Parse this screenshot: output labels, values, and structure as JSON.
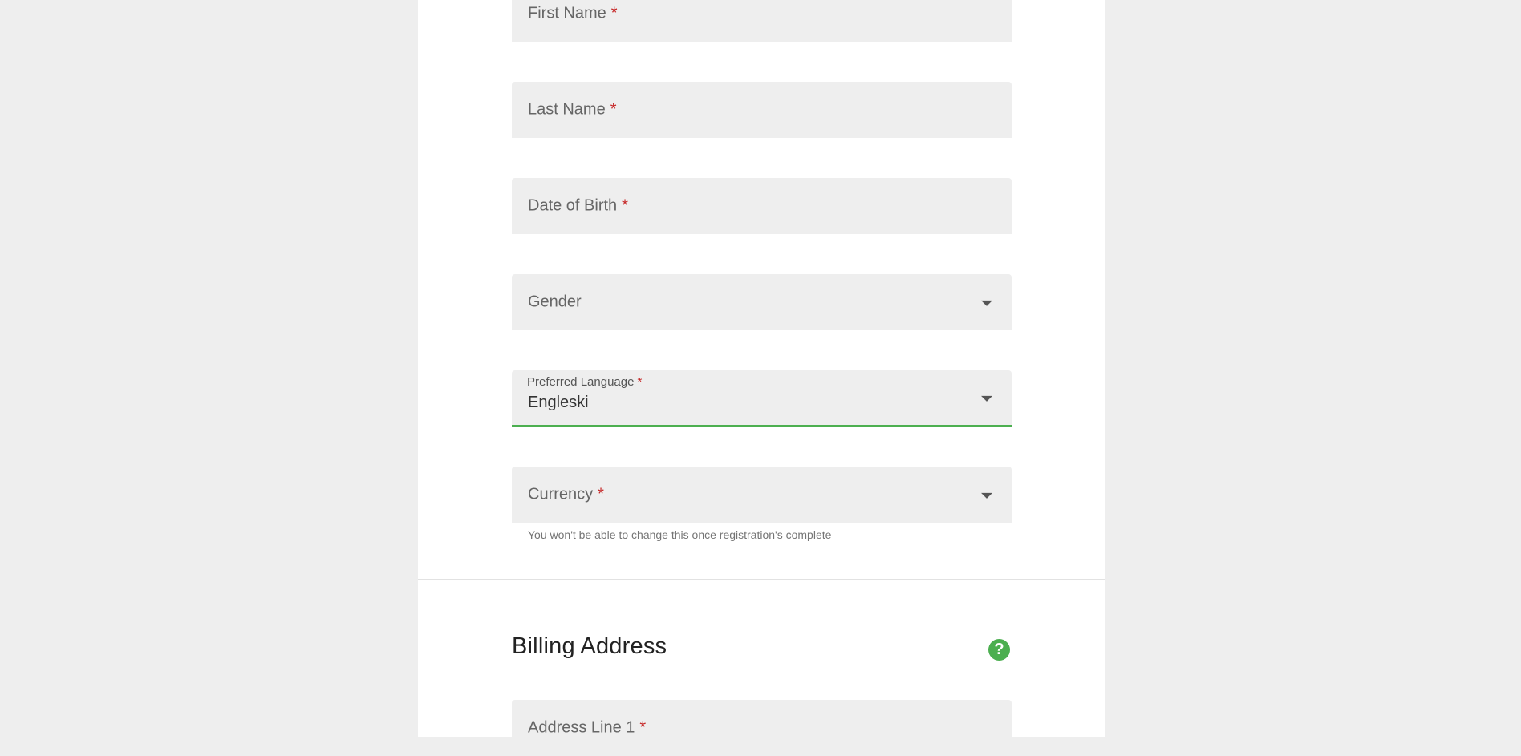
{
  "form": {
    "required_marker": "*",
    "first_name": {
      "label": "First Name"
    },
    "last_name": {
      "label": "Last Name"
    },
    "date_of_birth": {
      "label": "Date of Birth"
    },
    "gender": {
      "label": "Gender"
    },
    "preferred_language": {
      "label": "Preferred Language",
      "value": "Engleski"
    },
    "currency": {
      "label": "Currency",
      "helper": "You won't be able to change this once registration's complete"
    }
  },
  "billing": {
    "title": "Billing Address",
    "help_icon": "?",
    "address_line_1": {
      "label": "Address Line 1"
    }
  },
  "icons": {
    "dropdown": "chevron-down-icon",
    "help": "help-circle-icon"
  },
  "colors": {
    "accent": "#4caf50",
    "required": "#c62828",
    "field_bg": "#eeeeee",
    "page_bg": "#eeeeee"
  }
}
